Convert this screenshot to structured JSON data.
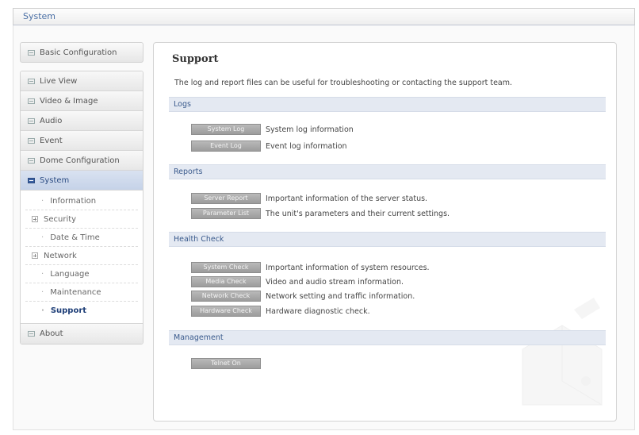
{
  "window": {
    "title": "System"
  },
  "sidebar": {
    "top_item": {
      "label": "Basic Configuration"
    },
    "items": [
      {
        "label": "Live View"
      },
      {
        "label": "Video & Image"
      },
      {
        "label": "Audio"
      },
      {
        "label": "Event"
      },
      {
        "label": "Dome Configuration"
      },
      {
        "label": "System"
      }
    ],
    "system_sub": [
      {
        "label": "Information",
        "type": "leaf"
      },
      {
        "label": "Security",
        "type": "expand"
      },
      {
        "label": "Date & Time",
        "type": "leaf"
      },
      {
        "label": "Network",
        "type": "expand"
      },
      {
        "label": "Language",
        "type": "leaf"
      },
      {
        "label": "Maintenance",
        "type": "leaf"
      },
      {
        "label": "Support",
        "type": "leaf",
        "current": true
      }
    ],
    "bottom_item": {
      "label": "About"
    }
  },
  "main": {
    "title": "Support",
    "description": "The log and report files can be useful for troubleshooting or contacting the support team.",
    "sections": {
      "logs": {
        "title": "Logs",
        "rows": [
          {
            "button": "System Log",
            "text": "System log information"
          },
          {
            "button": "Event Log",
            "text": "Event log information"
          }
        ]
      },
      "reports": {
        "title": "Reports",
        "rows": [
          {
            "button": "Server Report",
            "text": "Important information of the server status."
          },
          {
            "button": "Parameter List",
            "text": "The unit's parameters and their current settings."
          }
        ]
      },
      "health": {
        "title": "Health Check",
        "rows": [
          {
            "button": "System Check",
            "text": "Important information of system resources."
          },
          {
            "button": "Media Check",
            "text": "Video and audio stream information."
          },
          {
            "button": "Network Check",
            "text": "Network setting and traffic information."
          },
          {
            "button": "Hardware Check",
            "text": "Hardware diagnostic check."
          }
        ]
      },
      "management": {
        "title": "Management",
        "rows": [
          {
            "button": "Telnet On"
          }
        ]
      }
    }
  },
  "colors": {
    "accent": "#3a5a8c",
    "section_bg": "#e4e9f2",
    "button_bg": "#a8a8a8"
  }
}
